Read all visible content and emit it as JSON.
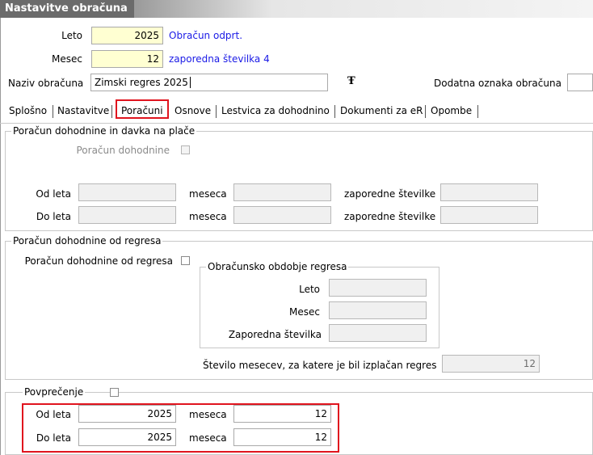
{
  "window": {
    "title": "Nastavitve obračuna"
  },
  "header": {
    "leto_label": "Leto",
    "leto_value": "2025",
    "leto_info": "Obračun odprt.",
    "mesec_label": "Mesec",
    "mesec_value": "12",
    "mesec_info": "zaporedna številka 4",
    "naziv_label": "Naziv obračuna",
    "naziv_value": "Zimski regres 2025",
    "dodatna_label": "Dodatna oznaka obračuna",
    "dodatna_value": "",
    "font_icon_glyph": "Ŧ"
  },
  "tabs": [
    {
      "label": "Splošno"
    },
    {
      "label": "Nastavitve"
    },
    {
      "label": "Poračuni"
    },
    {
      "label": "Osnove"
    },
    {
      "label": "Lestvica za dohodnino"
    },
    {
      "label": "Dokumenti za eR"
    },
    {
      "label": "Opombe"
    }
  ],
  "poracun_place": {
    "legend": "Poračun dohodnine in davka na plače",
    "checkbox_label": "Poračun dohodnine",
    "od_leta_label": "Od leta",
    "do_leta_label": "Do leta",
    "meseca_label": "meseca",
    "zaporedne_label": "zaporedne številke"
  },
  "poracun_regres": {
    "legend": "Poračun dohodnine od regresa",
    "checkbox_label": "Poračun dohodnine od regresa",
    "obdobje_legend": "Obračunsko obdobje regresa",
    "leto_label": "Leto",
    "mesec_label": "Mesec",
    "zaporedna_label": "Zaporedna številka",
    "stevilo_label": "Število mesecev, za katere je bil izplačan  regres",
    "stevilo_value": "12"
  },
  "povprecenje": {
    "legend": "Povprečenje",
    "od_leta_label": "Od leta",
    "od_leta_value": "2025",
    "od_meseca_label": "meseca",
    "od_meseca_value": "12",
    "do_leta_label": "Do leta",
    "do_leta_value": "2025",
    "do_meseca_label": "meseca",
    "do_meseca_value": "12"
  }
}
